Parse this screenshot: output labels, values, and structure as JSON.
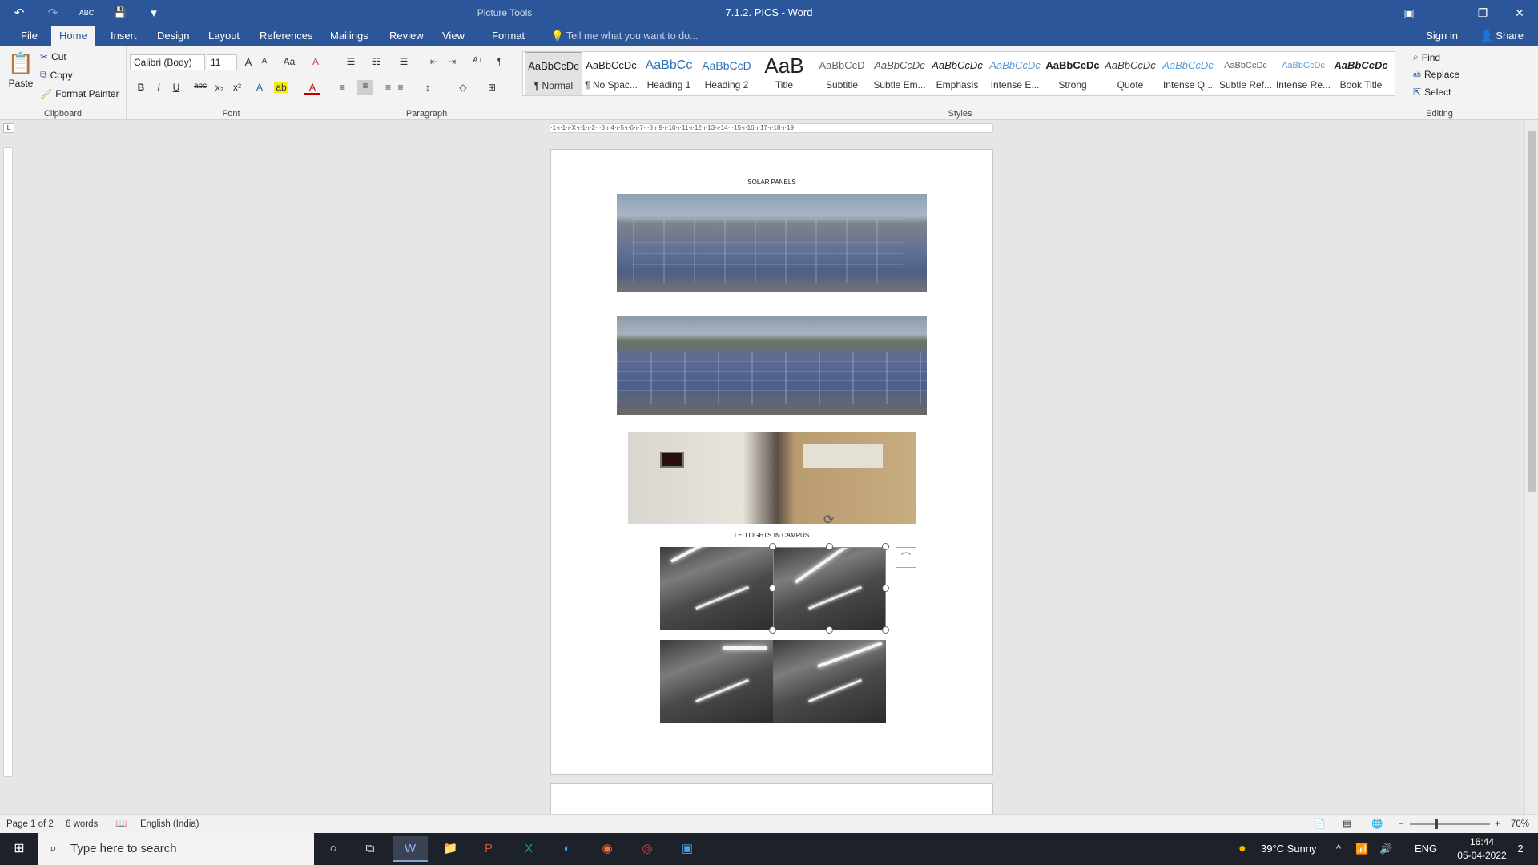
{
  "window": {
    "title": "7.1.2. PICS - Word",
    "contextual_tab_group": "Picture Tools",
    "controls": {
      "ribbon_display": "▣",
      "minimize": "—",
      "restore": "❐",
      "close": "✕"
    }
  },
  "qat": {
    "undo": "↶",
    "redo": "↷",
    "spelling": "ABC",
    "save": "💾",
    "customize": "▾"
  },
  "tabs": [
    "File",
    "Home",
    "Insert",
    "Design",
    "Layout",
    "References",
    "Mailings",
    "Review",
    "View",
    "Format"
  ],
  "tell_me": "Tell me what you want to do...",
  "sign_in": "Sign in",
  "share": "Share",
  "clipboard": {
    "label": "Clipboard",
    "paste": "Paste",
    "cut": "Cut",
    "copy": "Copy",
    "format_painter": "Format Painter"
  },
  "font": {
    "label": "Font",
    "name": "Calibri (Body)",
    "size": "11",
    "bold": "B",
    "italic": "I",
    "underline": "U",
    "strike": "abc",
    "sub": "x₂",
    "sup": "x²",
    "grow": "A",
    "shrink": "A",
    "case": "Aa",
    "clear": "A",
    "effects": "A",
    "highlight": "ab",
    "color": "A"
  },
  "paragraph": {
    "label": "Paragraph",
    "bullets": "☰",
    "numbering": "☷",
    "multilevel": "☰",
    "decrease": "⇤",
    "increase": "⇥",
    "sort": "A↓",
    "marks": "¶",
    "left": "≡",
    "center": "≡",
    "right": "≡",
    "justify": "≡",
    "spacing": "↕",
    "shading": "◇",
    "borders": "⊞"
  },
  "styles": {
    "label": "Styles",
    "items": [
      {
        "preview": "AaBbCcDc",
        "name": "¶ Normal"
      },
      {
        "preview": "AaBbCcDc",
        "name": "¶ No Spac..."
      },
      {
        "preview": "AaBbCc",
        "name": "Heading 1"
      },
      {
        "preview": "AaBbCcD",
        "name": "Heading 2"
      },
      {
        "preview": "AaB",
        "name": "Title"
      },
      {
        "preview": "AaBbCcD",
        "name": "Subtitle"
      },
      {
        "preview": "AaBbCcDc",
        "name": "Subtle Em..."
      },
      {
        "preview": "AaBbCcDc",
        "name": "Emphasis"
      },
      {
        "preview": "AaBbCcDc",
        "name": "Intense E..."
      },
      {
        "preview": "AaBbCcDc",
        "name": "Strong"
      },
      {
        "preview": "AaBbCcDc",
        "name": "Quote"
      },
      {
        "preview": "AaBbCcDc",
        "name": "Intense Q..."
      },
      {
        "preview": "AaBbCcDc",
        "name": "Subtle Ref..."
      },
      {
        "preview": "AaBbCcDc",
        "name": "Intense Re..."
      },
      {
        "preview": "AaBbCcDc",
        "name": "Book Title"
      }
    ]
  },
  "editing": {
    "label": "Editing",
    "find": "Find",
    "replace": "Replace",
    "select": "Select"
  },
  "ruler": "·1·ı·1·ı·X·ı·1·ı·2·ı·3·ı·4·ı·5·ı·6·ı·7·ı·8·ı·9·ı·10·ı·11·ı·12·ı·13·ı·14·ı·15·ı·16·ı·17·ı·18·ı·19·",
  "document": {
    "heading_solar": "SOLAR PANELS",
    "heading_led": "LED LIGHTS IN CAMPUS"
  },
  "status": {
    "page": "Page 1 of 2",
    "words": "6 words",
    "language": "English (India)",
    "zoom": "70%",
    "zoom_level": 0.7
  },
  "taskbar": {
    "search_placeholder": "Type here to search",
    "weather": "39°C  Sunny",
    "lang": "ENG",
    "time": "16:44",
    "date": "05-04-2022",
    "notifications": "2"
  },
  "colors": {
    "accent": "#2b579a",
    "ribbon_bg": "#f3f3f3",
    "taskbar_bg": "#1d2129"
  }
}
